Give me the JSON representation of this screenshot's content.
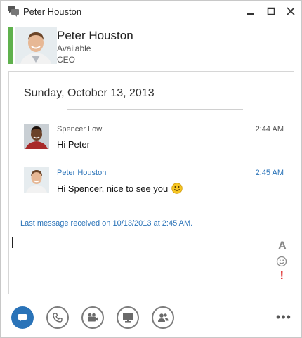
{
  "window": {
    "title": "Peter Houston",
    "controls": [
      "minimize-icon",
      "maximize-icon",
      "close-icon"
    ]
  },
  "contact": {
    "name": "Peter Houston",
    "status": "Available",
    "title": "CEO",
    "presence_color": "#5fb14d"
  },
  "conversation": {
    "date": "Sunday, October 13, 2013",
    "messages": [
      {
        "sender": "Spencer Low",
        "time": "2:44 AM",
        "text": "Hi Peter",
        "self": false
      },
      {
        "sender": "Peter Houston",
        "time": "2:45 AM",
        "text": "Hi Spencer, nice to see you",
        "self": true,
        "emoticon": "smiley-icon"
      }
    ],
    "status_line": "Last message received on 10/13/2013 at 2:45 AM."
  },
  "compose": {
    "value": "",
    "font_label": "A",
    "priority_label": "!"
  },
  "toolbar": {
    "buttons": [
      "im-icon",
      "phone-icon",
      "video-icon",
      "present-icon",
      "people-icon"
    ],
    "more_label": "•••"
  },
  "colors": {
    "accent": "#2a73b8",
    "presence": "#5fb14d",
    "priority": "#dd2222"
  }
}
